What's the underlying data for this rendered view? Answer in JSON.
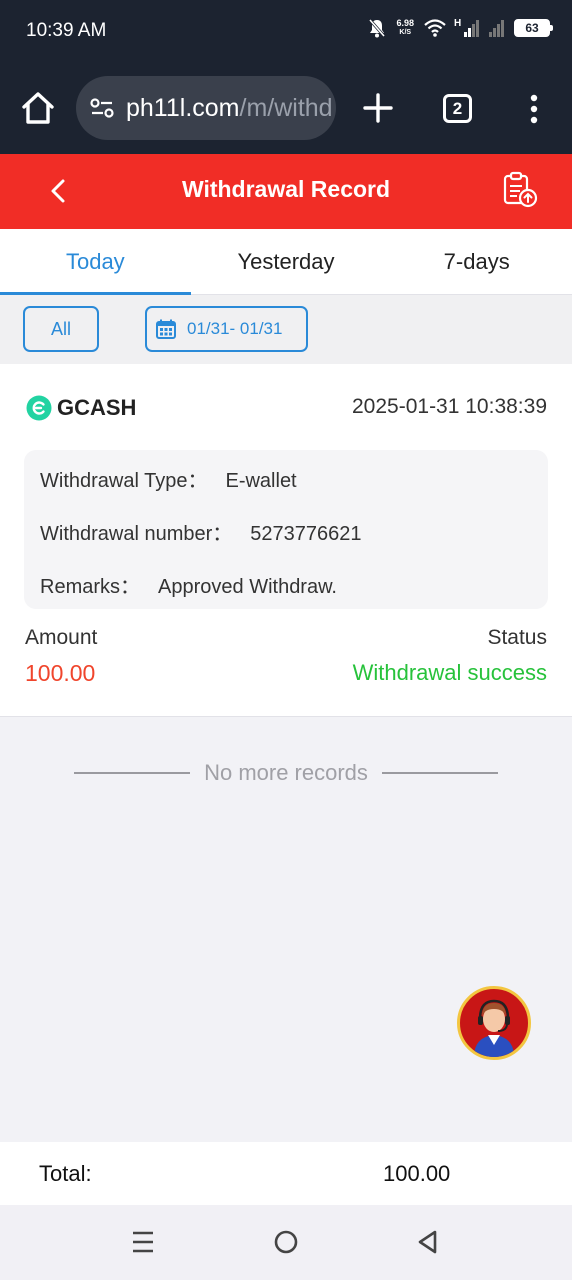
{
  "status_bar": {
    "time": "10:39 AM",
    "net_speed_value": "6.98",
    "net_speed_unit": "K/S",
    "signal_label": "H",
    "battery": "63"
  },
  "browser": {
    "url_main": "ph11l.com",
    "url_path": "/m/withd",
    "tab_count": "2"
  },
  "header": {
    "title": "Withdrawal Record"
  },
  "tabs": [
    {
      "label": "Today",
      "active": true
    },
    {
      "label": "Yesterday",
      "active": false
    },
    {
      "label": "7-days",
      "active": false
    }
  ],
  "filters": {
    "type_label": "All",
    "date_range": "01/31- 01/31"
  },
  "record": {
    "method": "GCASH",
    "datetime": "2025-01-31 10:38:39",
    "withdrawal_type_label": "Withdrawal Type：",
    "withdrawal_type_value": "E-wallet",
    "withdrawal_number_label": "Withdrawal number：",
    "withdrawal_number_value": "5273776621",
    "remarks_label": "Remarks：",
    "remarks_value": "Approved Withdraw.",
    "amount_label": "Amount",
    "amount_value": "100.00",
    "status_label": "Status",
    "status_value": "Withdrawal success"
  },
  "list_footer": {
    "text": "No more records"
  },
  "total": {
    "label": "Total:",
    "value": "100.00"
  },
  "colors": {
    "header_red": "#f12d26",
    "accent_blue": "#2a8ad8",
    "amount_red": "#f0452c",
    "success_green": "#27c23b"
  }
}
